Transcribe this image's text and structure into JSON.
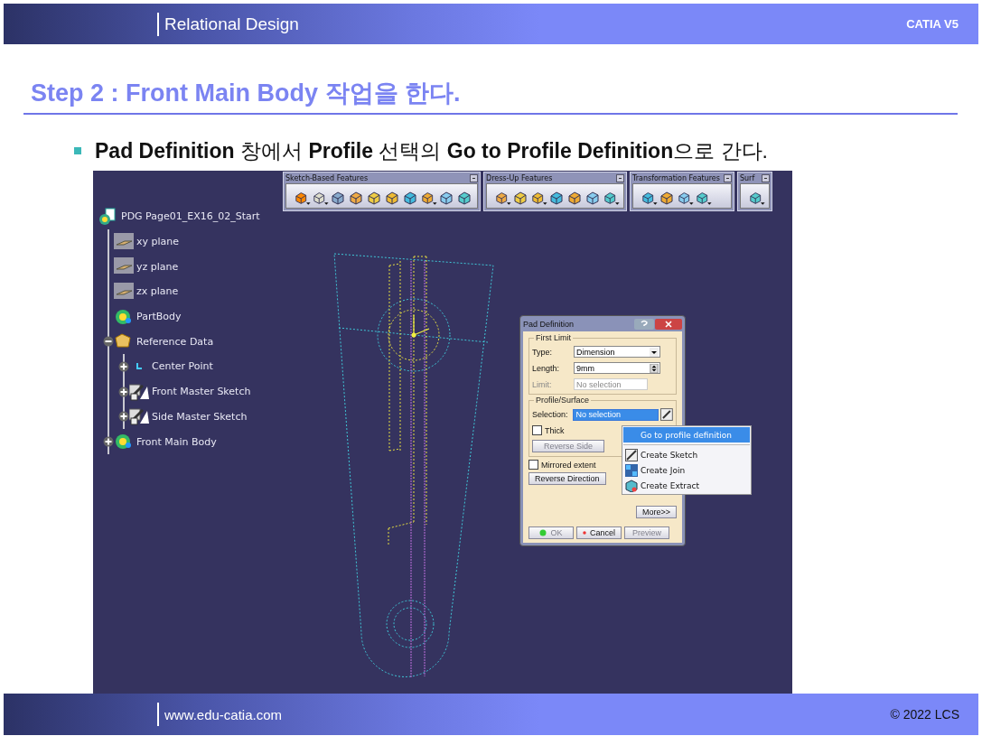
{
  "header": {
    "title": "Relational Design",
    "product": "CATIA V5"
  },
  "heading": "Step 2 : Front Main Body 작업을 한다.",
  "bullet": "**Pad Definition** 창에서 **Profile** 선택의 **Go to Profile Definition**으로 간다.",
  "tree": {
    "label": "PDG Page01_EX16_02_Start",
    "kind": "product",
    "children": [
      {
        "label": "xy plane",
        "kind": "plane"
      },
      {
        "label": "yz plane",
        "kind": "plane"
      },
      {
        "label": "zx plane",
        "kind": "plane"
      },
      {
        "label": "PartBody",
        "kind": "body"
      },
      {
        "label": "Reference Data",
        "kind": "reference",
        "expanded": true,
        "children": [
          {
            "label": "Center Point",
            "kind": "point",
            "expanded": false
          },
          {
            "label": "Front Master Sketch",
            "kind": "sketch",
            "expanded": false
          },
          {
            "label": "Side Master Sketch",
            "kind": "sketch",
            "expanded": false
          }
        ]
      },
      {
        "label": "Front Main Body",
        "kind": "body",
        "expanded": false
      }
    ]
  },
  "toolbars": [
    {
      "title": "Sketch-Based Features",
      "tools": [
        {
          "dropdown": true
        },
        {
          "dropdown": true
        },
        {
          "dropdown": false
        },
        {
          "dropdown": false
        },
        {
          "dropdown": false
        },
        {
          "dropdown": false
        },
        {
          "dropdown": false
        },
        {
          "dropdown": true
        },
        {
          "dropdown": false
        },
        {
          "dropdown": false
        }
      ]
    },
    {
      "title": "Dress-Up Features",
      "tools": [
        {
          "dropdown": true
        },
        {
          "dropdown": false
        },
        {
          "dropdown": true
        },
        {
          "dropdown": false
        },
        {
          "dropdown": false
        },
        {
          "dropdown": false
        },
        {
          "dropdown": true
        }
      ]
    },
    {
      "title": "Transformation Features",
      "tools": [
        {
          "dropdown": true
        },
        {
          "dropdown": false
        },
        {
          "dropdown": true
        },
        {
          "dropdown": true
        }
      ]
    },
    {
      "title": "Surf",
      "tools": [
        {
          "dropdown": true
        }
      ]
    }
  ],
  "dialog": {
    "title": "Pad Definition",
    "groups": [
      {
        "title": "First Limit",
        "rows": [
          {
            "kind": "dropdown",
            "label": "Type:",
            "value": "Dimension"
          },
          {
            "kind": "spinner",
            "label": "Length:",
            "value": "9mm"
          },
          {
            "kind": "field",
            "label": "Limit:",
            "value": "No selection",
            "disabled": true
          }
        ]
      },
      {
        "title": "Profile/Surface",
        "rows": [
          {
            "kind": "selection",
            "label": "Selection:",
            "value": "No selection",
            "selected": true
          },
          {
            "kind": "checkbox",
            "label": "Thick",
            "checked": false
          },
          {
            "kind": "button",
            "label": "Reverse Side",
            "disabled": true
          }
        ]
      }
    ],
    "options": [
      {
        "kind": "checkbox",
        "label": "Mirrored extent",
        "checked": false
      },
      {
        "kind": "button",
        "label": "Reverse Direction",
        "disabled": false
      }
    ],
    "more": "More>>",
    "buttons": [
      {
        "kind": "ok",
        "label": "OK",
        "disabled": true
      },
      {
        "kind": "cancel",
        "label": "Cancel",
        "disabled": false
      },
      {
        "kind": "plain",
        "label": "Preview",
        "disabled": true
      }
    ]
  },
  "menu": [
    {
      "kind": "plain",
      "label": "Go to profile definition",
      "selected": true
    },
    {
      "kind": "sketch",
      "label": "Create Sketch",
      "selected": false
    },
    {
      "kind": "join",
      "label": "Create Join",
      "selected": false
    },
    {
      "kind": "extract",
      "label": "Create Extract",
      "selected": false
    }
  ],
  "footer": {
    "url": "www.edu-catia.com",
    "copyright": "© 2022 LCS"
  }
}
